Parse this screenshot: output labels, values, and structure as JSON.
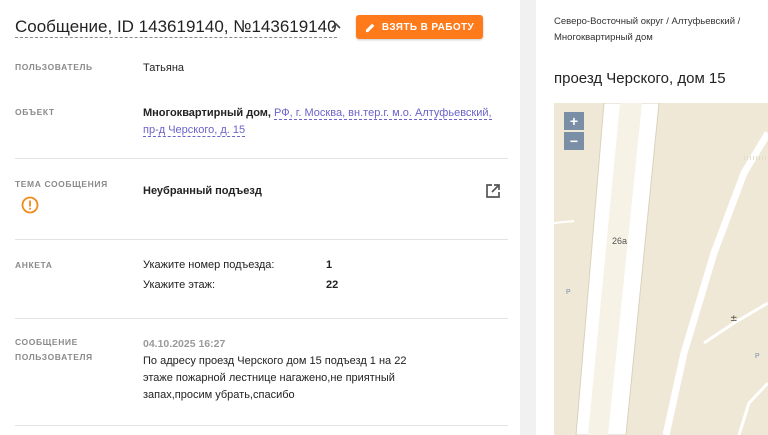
{
  "header": {
    "title": "Сообщение, ID 143619140, №143619140",
    "take_button_label": "ВЗЯТЬ В РАБОТУ"
  },
  "fields": {
    "user": {
      "label": "ПОЛЬЗОВАТЕЛЬ",
      "value": "Татьяна"
    },
    "object": {
      "label": "ОБЪЕКТ",
      "type": "Многоквартирный дом,",
      "address_line1": "РФ, г. Москва, вн.тер.г. м.о. Алтуфьевский,",
      "address_line2": "пр-д Черского, д. 15"
    },
    "topic": {
      "label": "ТЕМА СООБЩЕНИЯ",
      "value": "Неубранный подъезд"
    },
    "survey": {
      "label": "АНКЕТА",
      "rows": [
        {
          "q": "Укажите номер подъезда:",
          "a": "1"
        },
        {
          "q": "Укажите этаж:",
          "a": "22"
        }
      ]
    },
    "message": {
      "label_line1": "СООБЩЕНИЕ",
      "label_line2": "ПОЛЬЗОВАТЕЛЯ",
      "date": "04.10.2025 16:27",
      "text": "По адресу проезд Черского дом 15 подъезд 1 на 22 этаже пожарной лестнице нагажено,не приятный запах,просим убрать,спасибо"
    }
  },
  "sidebar": {
    "breadcrumb": "Северо-Восточный округ / Алтуфьевский / Многоквартирный дом",
    "address": "проезд Черского, дом 15"
  },
  "map": {
    "zoom_in": "+",
    "zoom_out": "−",
    "building_label": "26а",
    "parking_label": "P"
  },
  "colors": {
    "accent": "#ff7a1a",
    "link": "#6a63c9",
    "warning": "#f08c1a",
    "map_bg": "#efe8d6"
  },
  "icons": {
    "title_toggle": "chevron-up-icon",
    "take_button": "pencil-icon",
    "topic_status": "warning-icon",
    "topic_open": "external-link-icon"
  }
}
